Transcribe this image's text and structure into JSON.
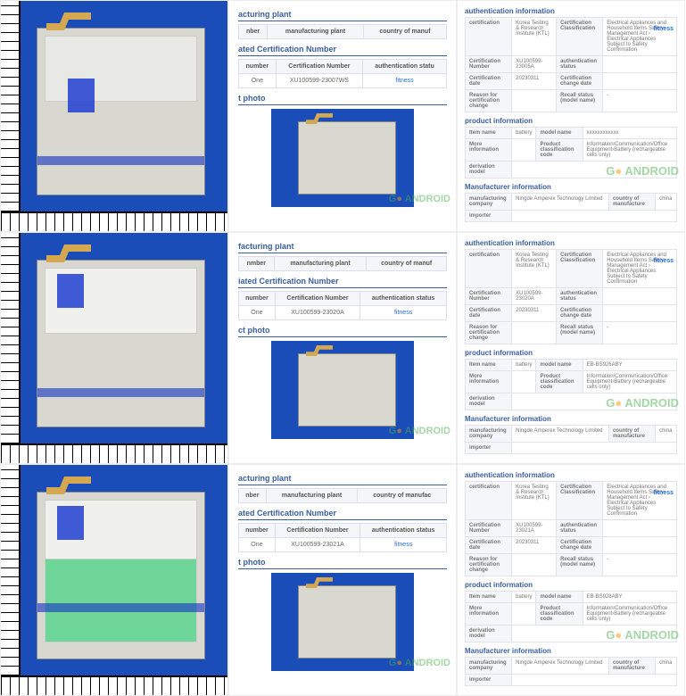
{
  "rows": [
    {
      "auth": {
        "certification": {
          "k": "certification",
          "v": "Korea Testing & Research Institute (KTL)"
        },
        "class": {
          "k": "Certification Classification",
          "v": "Electrical Appliances and Household Items Safety Management Act › Electrical Appliances Subject to Safety Confirmation"
        },
        "number": {
          "k": "Certification Number",
          "v": "XU100599-23005A"
        },
        "authstat": {
          "k": "authentication status",
          "v": ""
        },
        "date": {
          "k": "Certification date",
          "v": "20230311"
        },
        "chgdate": {
          "k": "Certification change date",
          "v": ""
        },
        "reason": {
          "k": "Reason for certification change",
          "v": ""
        },
        "recall": {
          "k": "Recall status (model name)",
          "v": "-"
        },
        "link": "fitness"
      },
      "prod": {
        "item": {
          "k": "Item name",
          "v": "battery"
        },
        "model": {
          "k": "model name",
          "v": "xxxxxxxxxxxx"
        },
        "more": {
          "k": "More information",
          "v": ""
        },
        "pclass": {
          "k": "Product classification code",
          "v": "Information/Communication/Office Equipment›Battery (rechargeable cells only)"
        },
        "deriv": {
          "k": "derivation model",
          "v": ""
        }
      },
      "mfg": {
        "company": {
          "k": "manufacturing company",
          "v": "Ningde Amperex Technology Limited"
        },
        "country": {
          "k": "country of manufacture",
          "v": "china"
        },
        "importer": {
          "k": "importer",
          "v": ""
        }
      },
      "cert": {
        "secPlant": "acturing plant",
        "hPlant": [
          "nber",
          "manufacturing plant",
          "country of manuf"
        ],
        "secCert": "ated Certification Number",
        "hCert": [
          "number",
          "Certification Number",
          "authentication statu"
        ],
        "row": [
          "One",
          "XU100599-23007WS",
          "fitness"
        ],
        "secPhoto": "t photo"
      }
    },
    {
      "auth": {
        "certification": {
          "k": "certification",
          "v": "Korea Testing & Research Institute (KTL)"
        },
        "class": {
          "k": "Certification Classification",
          "v": "Electrical Appliances and Household Items Safety Management Act › Electrical Appliances Subject to Safety Confirmation"
        },
        "number": {
          "k": "Certification Number",
          "v": "XU100599-23020A"
        },
        "authstat": {
          "k": "authentication status",
          "v": ""
        },
        "date": {
          "k": "Certification date",
          "v": "20230311"
        },
        "chgdate": {
          "k": "Certification change date",
          "v": ""
        },
        "reason": {
          "k": "Reason for certification change",
          "v": ""
        },
        "recall": {
          "k": "Recall status (model name)",
          "v": "-"
        },
        "link": "fitness"
      },
      "prod": {
        "item": {
          "k": "Item name",
          "v": "battery"
        },
        "model": {
          "k": "model name",
          "v": "EB-BS926ABY"
        },
        "more": {
          "k": "More information",
          "v": ""
        },
        "pclass": {
          "k": "Product classification code",
          "v": "Information/Communication/Office Equipment›Battery (rechargeable cells only)"
        },
        "deriv": {
          "k": "derivation model",
          "v": ""
        }
      },
      "mfg": {
        "company": {
          "k": "manufacturing company",
          "v": "Ningde Amperex Technology Limited"
        },
        "country": {
          "k": "country of manufacture",
          "v": "china"
        },
        "importer": {
          "k": "importer",
          "v": ""
        }
      },
      "cert": {
        "secPlant": "facturing plant",
        "hPlant": [
          "nmber",
          "manufacturing plant",
          "country of manuf"
        ],
        "secCert": "iated Certification Number",
        "hCert": [
          "number",
          "Certification Number",
          "authentication status"
        ],
        "row": [
          "One",
          "XU100599-23020A",
          "fitness"
        ],
        "secPhoto": "ct photo"
      }
    },
    {
      "auth": {
        "certification": {
          "k": "certification",
          "v": "Korea Testing & Research Institute (KTL)"
        },
        "class": {
          "k": "Certification Classification",
          "v": "Electrical Appliances and Household Items Safety Management Act › Electrical Appliances Subject to Safety Confirmation"
        },
        "number": {
          "k": "Certification Number",
          "v": "XU100599-23021A"
        },
        "authstat": {
          "k": "authentication status",
          "v": ""
        },
        "date": {
          "k": "Certification date",
          "v": "20230311"
        },
        "chgdate": {
          "k": "Certification change date",
          "v": ""
        },
        "reason": {
          "k": "Reason for certification change",
          "v": ""
        },
        "recall": {
          "k": "Recall status (model name)",
          "v": "-"
        },
        "link": "fitness"
      },
      "prod": {
        "item": {
          "k": "Item name",
          "v": "battery"
        },
        "model": {
          "k": "model name",
          "v": "EB-BS928ABY"
        },
        "more": {
          "k": "More information",
          "v": ""
        },
        "pclass": {
          "k": "Product classification code",
          "v": "Information/Communication/Office Equipment›Battery (rechargeable cells only)"
        },
        "deriv": {
          "k": "derivation model",
          "v": ""
        }
      },
      "mfg": {
        "company": {
          "k": "manufacturing company",
          "v": "Ningde Amperex Technology Limited"
        },
        "country": {
          "k": "country of manufacture",
          "v": "china"
        },
        "importer": {
          "k": "importer",
          "v": ""
        }
      },
      "cert": {
        "secPlant": "acturing plant",
        "hPlant": [
          "nber",
          "manufacturing plant",
          "country of manufac"
        ],
        "secCert": "ated Certification Number",
        "hCert": [
          "number",
          "Certification Number",
          "authentication status"
        ],
        "row": [
          "One",
          "XU100599-23021A",
          "fitness"
        ],
        "secPhoto": "t photo"
      }
    }
  ],
  "wm": "G  ANDROID",
  "sections": {
    "auth": "authentication information",
    "prod": "product information",
    "mfg": "Manufacturer information"
  }
}
